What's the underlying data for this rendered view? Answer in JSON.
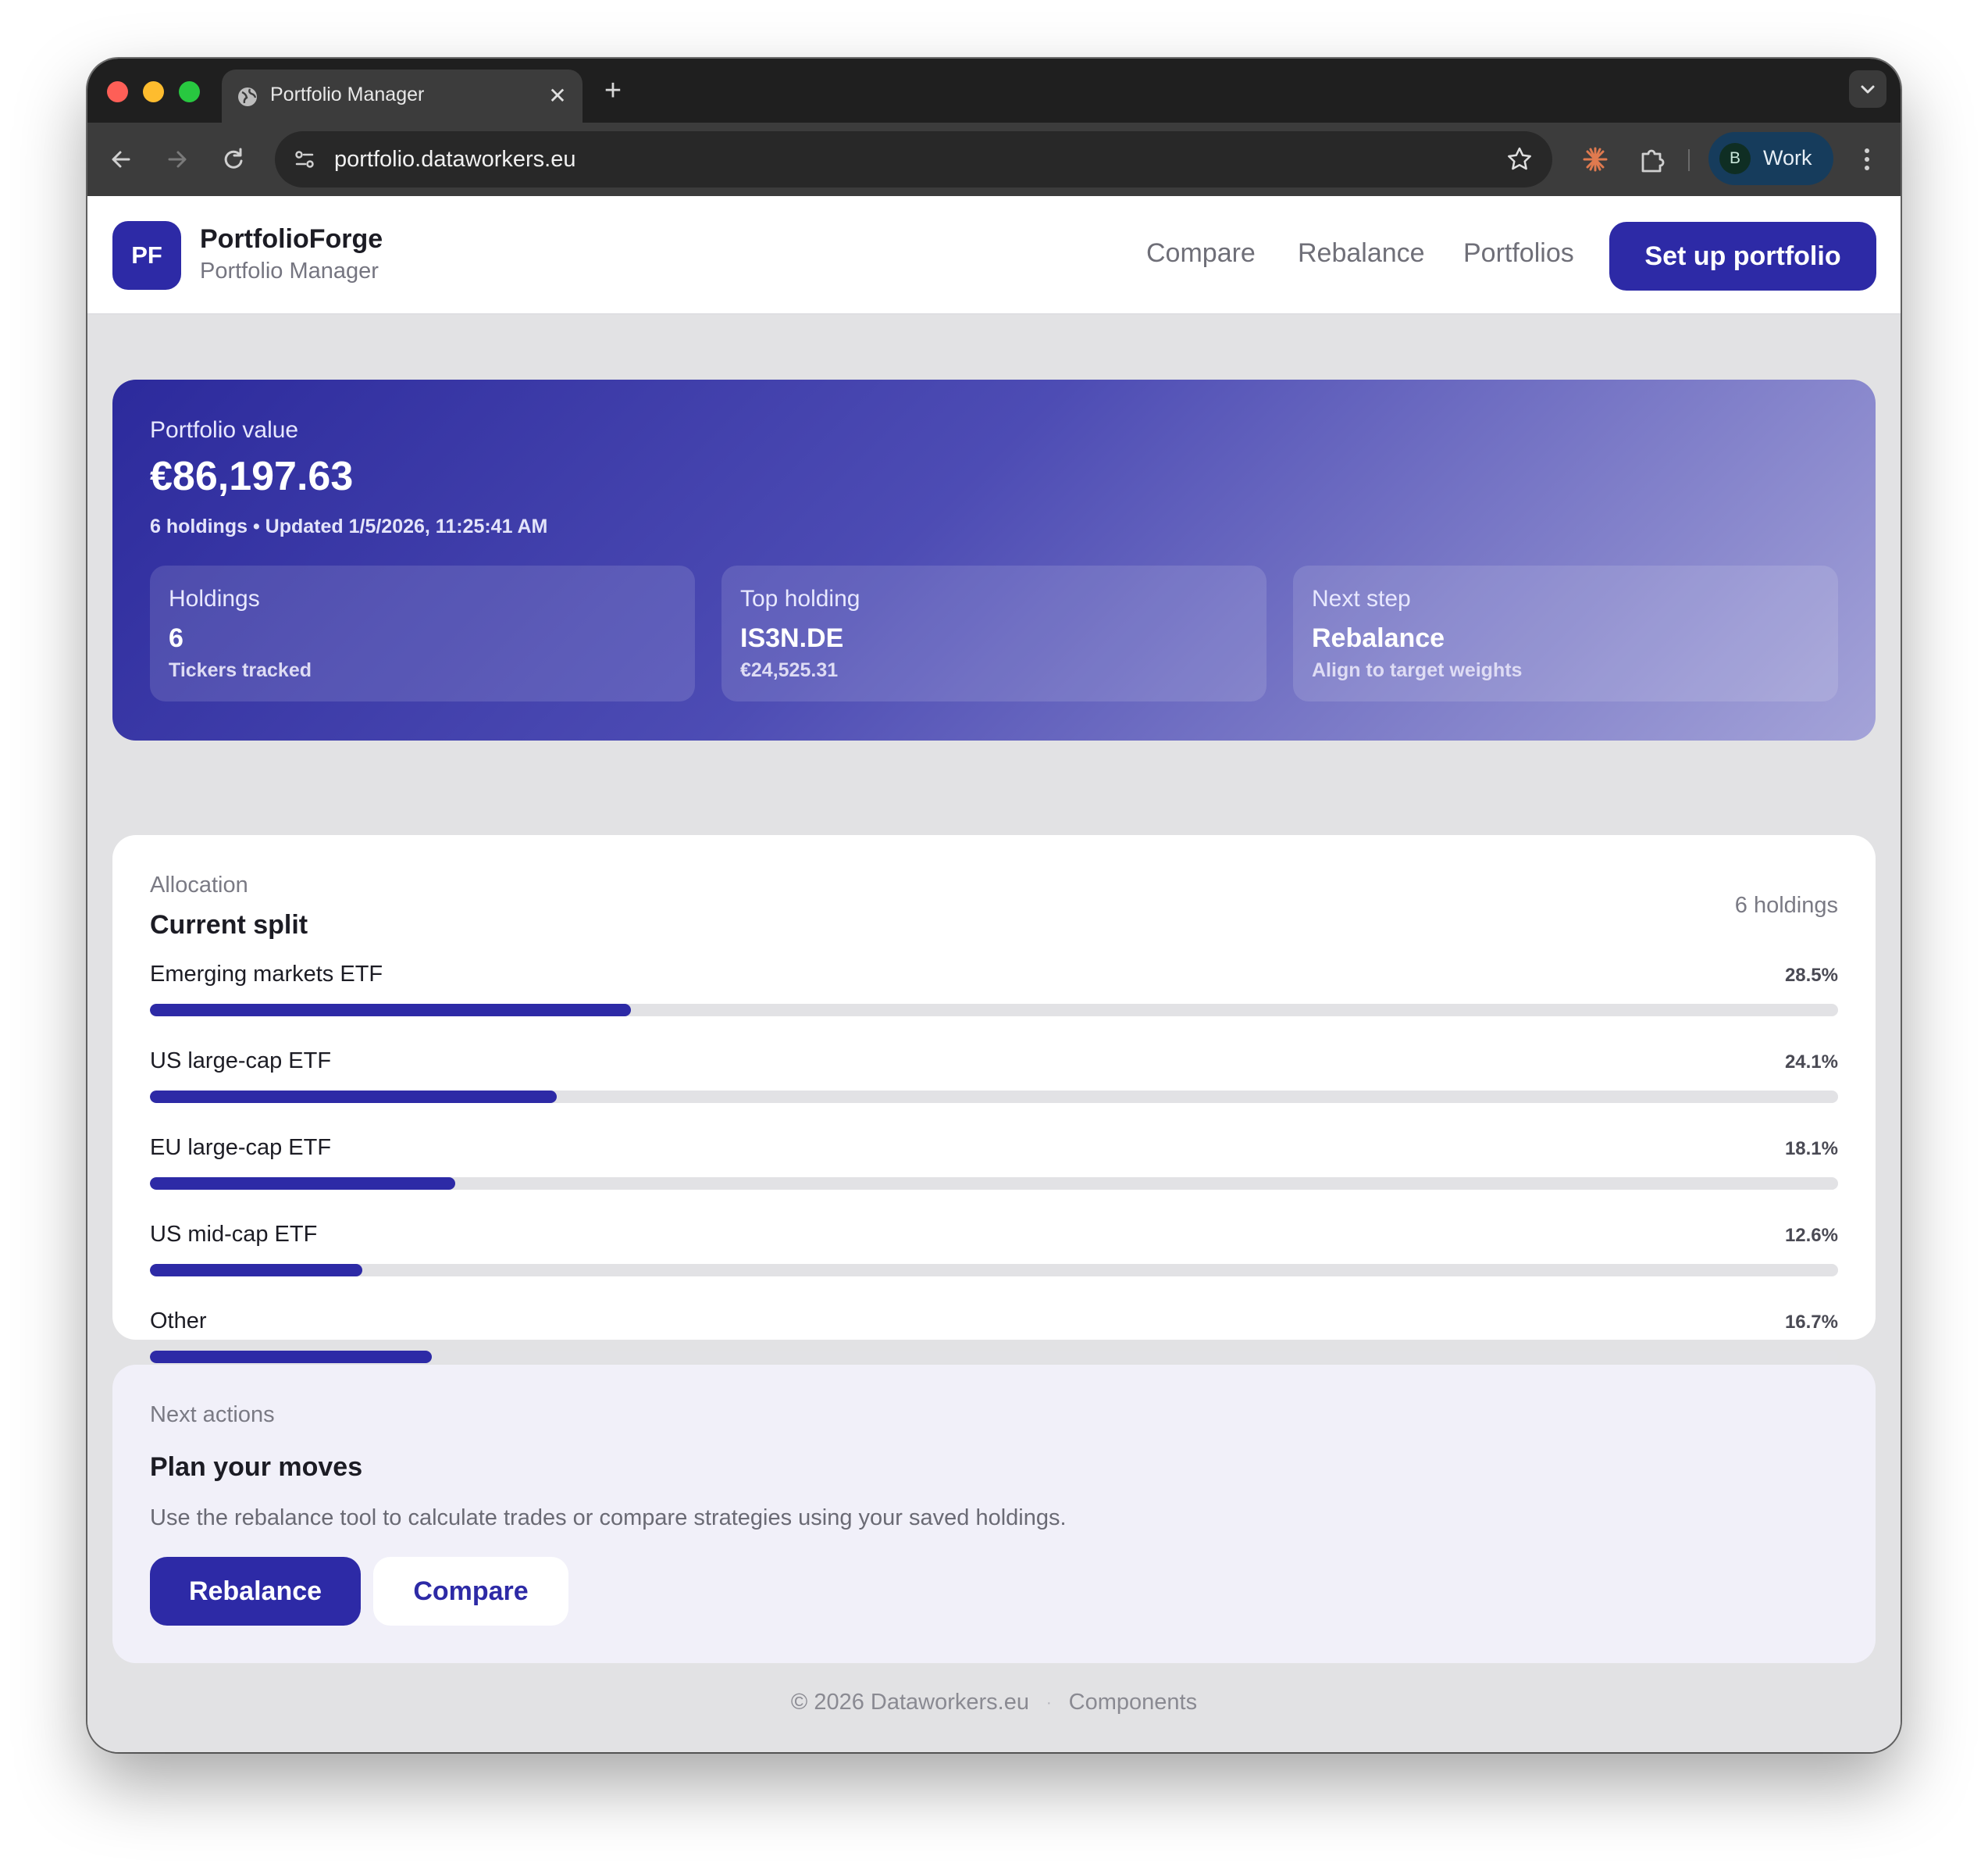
{
  "browser": {
    "tab_title": "Portfolio Manager",
    "tab_close": "✕",
    "new_tab": "+",
    "url": "portfolio.dataworkers.eu",
    "profile_initial": "B",
    "profile_label": "Work"
  },
  "header": {
    "logo_text": "PF",
    "brand_name": "PortfolioForge",
    "brand_subtitle": "Portfolio Manager",
    "nav": [
      "Compare",
      "Rebalance",
      "Portfolios"
    ],
    "cta_label": "Set up portfolio"
  },
  "hero": {
    "label": "Portfolio value",
    "value": "€86,197.63",
    "meta": "6 holdings • Updated 1/5/2026, 11:25:41 AM",
    "stats": [
      {
        "label": "Holdings",
        "value": "6",
        "sub": "Tickers tracked"
      },
      {
        "label": "Top holding",
        "value": "IS3N.DE",
        "sub": "€24,525.31"
      },
      {
        "label": "Next step",
        "value": "Rebalance",
        "sub": "Align to target weights"
      }
    ]
  },
  "allocation": {
    "kicker": "Allocation",
    "title": "Current split",
    "count": "6 holdings",
    "rows": [
      {
        "label": "Emerging markets ETF",
        "pct": "28.5%",
        "value": 28.5
      },
      {
        "label": "US large-cap ETF",
        "pct": "24.1%",
        "value": 24.1
      },
      {
        "label": "EU large-cap ETF",
        "pct": "18.1%",
        "value": 18.1
      },
      {
        "label": "US mid-cap ETF",
        "pct": "12.6%",
        "value": 12.6
      },
      {
        "label": "Other",
        "pct": "16.7%",
        "value": 16.7
      }
    ]
  },
  "next_actions": {
    "kicker": "Next actions",
    "title": "Plan your moves",
    "description": "Use the rebalance tool to calculate trades or compare strategies using your saved holdings.",
    "primary_label": "Rebalance",
    "secondary_label": "Compare"
  },
  "footer": {
    "copyright": "© 2026 Dataworkers.eu",
    "separator": "·",
    "link": "Components"
  },
  "colors": {
    "accent": "#2d2aa6",
    "bar_track": "#e2e2e5",
    "hero_start": "#2c2a9c",
    "hero_end": "#a4a3d8"
  }
}
